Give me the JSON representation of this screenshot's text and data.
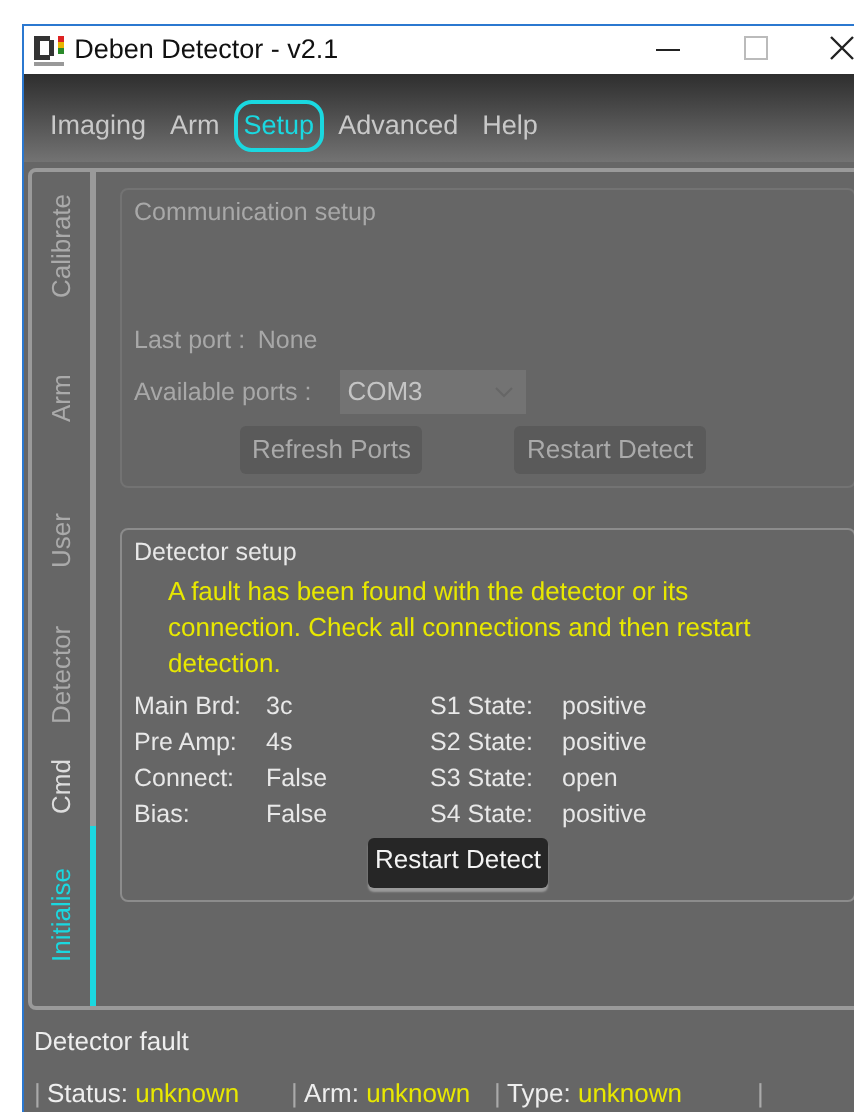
{
  "window": {
    "title": "Deben Detector - v2.1"
  },
  "menu": [
    {
      "label": "Imaging",
      "selected": false
    },
    {
      "label": "Arm",
      "selected": false
    },
    {
      "label": "Setup",
      "selected": true
    },
    {
      "label": "Advanced",
      "selected": false
    },
    {
      "label": "Help",
      "selected": false
    }
  ],
  "side_tabs": [
    {
      "label": "Calibrate",
      "selected": false,
      "disabled": true
    },
    {
      "label": "Arm",
      "selected": false,
      "disabled": true
    },
    {
      "label": "User",
      "selected": false,
      "disabled": true
    },
    {
      "label": "Detector",
      "selected": false,
      "disabled": true
    },
    {
      "label": "Cmd",
      "selected": false,
      "disabled": false
    },
    {
      "label": "Initialise",
      "selected": true,
      "disabled": false
    }
  ],
  "communication_setup": {
    "title": "Communication setup",
    "disabled": true,
    "last_port_label": "Last port :",
    "last_port_value": "None",
    "ports_label": "Available ports :",
    "port_value": "COM3",
    "buttons": [
      "Refresh Ports",
      "Restart Detect"
    ]
  },
  "detector_setup": {
    "title": "Detector setup",
    "message": "A fault has been found with the detector or its connection. Check all connections and then restart detection.",
    "left_fields": [
      {
        "label": "Main Brd:",
        "value": "3c"
      },
      {
        "label": "Pre Amp:",
        "value": "4s"
      },
      {
        "label": "Connect:",
        "value": "False"
      },
      {
        "label": "Bias:",
        "value": "False"
      }
    ],
    "right_fields": [
      {
        "label": "S1 State:",
        "value": "positive"
      },
      {
        "label": "S2 State:",
        "value": "positive"
      },
      {
        "label": "S3 State:",
        "value": "open"
      },
      {
        "label": "S4 State:",
        "value": "positive"
      }
    ],
    "button": "Restart Detect"
  },
  "status_bar": {
    "message": "Detector fault",
    "items": [
      {
        "separator": "|",
        "label": "Status:",
        "value": "unknown"
      },
      {
        "separator": "|",
        "label": "Arm:",
        "value": "unknown"
      },
      {
        "separator": "|",
        "label": "Type:",
        "value": "unknown"
      }
    ],
    "end_separator": "|"
  }
}
